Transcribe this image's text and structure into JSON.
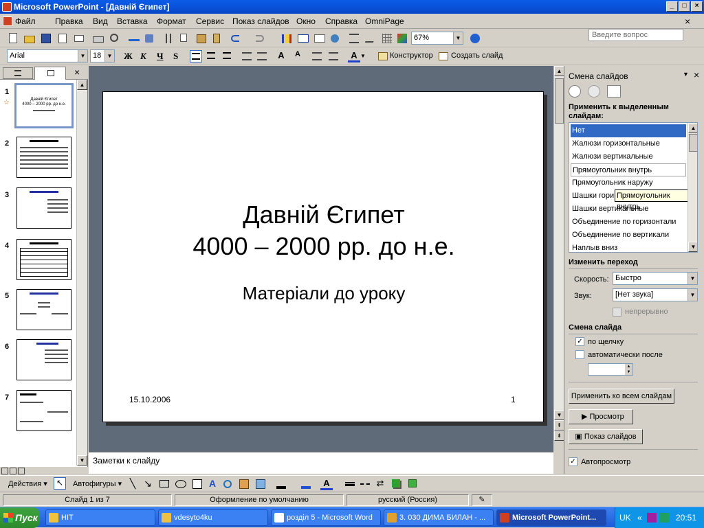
{
  "window": {
    "title": "Microsoft PowerPoint - [Давній Єгипет]",
    "min": "_",
    "max": "□",
    "close": "×"
  },
  "menu": {
    "items": [
      "Файл",
      "Правка",
      "Вид",
      "Вставка",
      "Формат",
      "Сервис",
      "Показ слайдов",
      "Окно",
      "Справка",
      "OmniPage"
    ],
    "help_placeholder": "Введите вопрос",
    "help_close": "×"
  },
  "toolbar_standard": {
    "zoom": "67%"
  },
  "toolbar_format": {
    "font": "Arial",
    "size": "18",
    "bold": "Ж",
    "italic": "К",
    "underline": "Ч",
    "shadow": "S",
    "designer": "Конструктор",
    "new_slide": "Создать слайд"
  },
  "outline": {
    "close": "×",
    "thumbnails": [
      {
        "num": "1"
      },
      {
        "num": "2"
      },
      {
        "num": "3"
      },
      {
        "num": "4"
      },
      {
        "num": "5"
      },
      {
        "num": "6"
      },
      {
        "num": "7"
      }
    ],
    "t1_title": "Давній Єгипет",
    "t1_sub": "4000 – 2000 рр. до н.е."
  },
  "slide": {
    "title_line1": "Давній Єгипет",
    "title_line2": "4000 – 2000 рр. до н.е.",
    "subtitle": "Матеріали до уроку",
    "date": "15.10.2006",
    "number": "1"
  },
  "notes": {
    "placeholder": "Заметки к слайду"
  },
  "task_pane": {
    "title": "Смена слайдов",
    "apply_heading": "Применить к выделенным слайдам:",
    "transitions": [
      "Нет",
      "Жалюзи горизонтальные",
      "Жалюзи вертикальные",
      "Прямоугольник внутрь",
      "Прямоугольник наружу",
      "Шашки гори",
      "Шашки вертикальные",
      "Объединение по горизонтали",
      "Объединение по вертикали",
      "Наплыв вниз"
    ],
    "tooltip": "Прямоугольник внутрь",
    "modify_heading": "Изменить переход",
    "speed_label": "Скорость:",
    "speed_value": "Быстро",
    "sound_label": "Звук:",
    "sound_value": "[Нет звука]",
    "loop_label": "непрерывно",
    "advance_heading": "Смена слайда",
    "on_click": "по щелчку",
    "auto_after": "автоматически после",
    "apply_all": "Применить ко всем слайдам",
    "play": "Просмотр",
    "slideshow": "Показ слайдов",
    "autopreview": "Автопросмотр"
  },
  "drawing": {
    "actions": "Действия",
    "autoshapes": "Автофигуры"
  },
  "status": {
    "slide": "Слайд 1 из 7",
    "design": "Оформление по умолчанию",
    "lang": "русский (Россия)"
  },
  "taskbar": {
    "start": "Пуск",
    "tasks": [
      "HIT",
      "vdesyto4ku",
      "розділ 5 - Microsoft Word",
      "3. 030 ДИМА БИЛАН - ...",
      "Microsoft PowerPoint..."
    ],
    "lang": "UK",
    "time": "20:51"
  }
}
